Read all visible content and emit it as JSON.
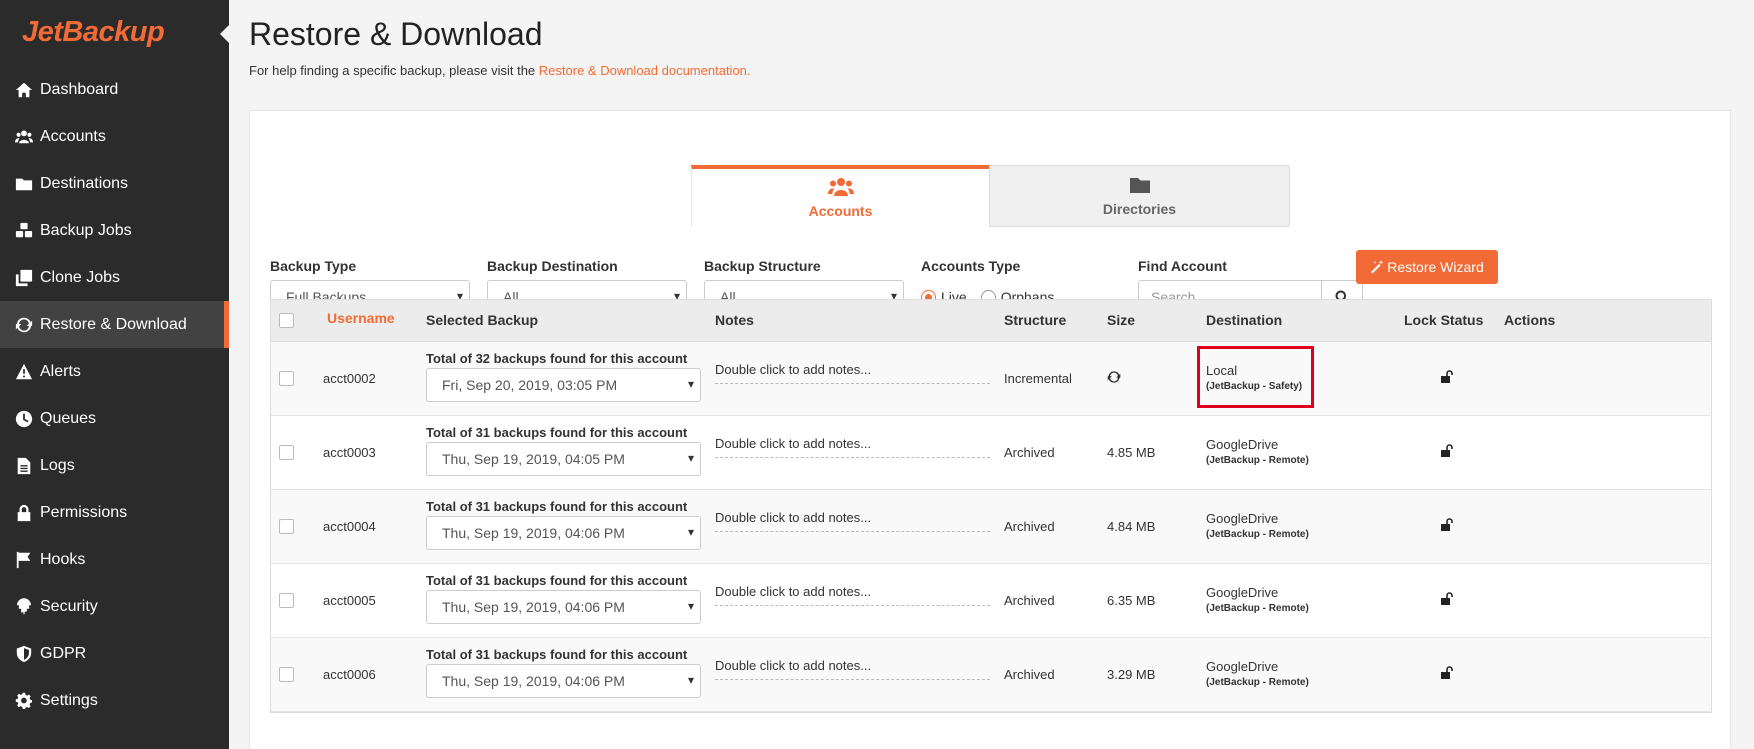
{
  "brand": {
    "logo_text": "JetBackup",
    "accent": "#f26b36"
  },
  "sidebar": {
    "items": [
      {
        "label": "Dashboard",
        "icon": "home-icon"
      },
      {
        "label": "Accounts",
        "icon": "users-icon"
      },
      {
        "label": "Destinations",
        "icon": "folder-icon"
      },
      {
        "label": "Backup Jobs",
        "icon": "cubes-icon"
      },
      {
        "label": "Clone Jobs",
        "icon": "clone-icon"
      },
      {
        "label": "Restore & Download",
        "icon": "refresh-icon",
        "active": true
      },
      {
        "label": "Alerts",
        "icon": "warning-icon"
      },
      {
        "label": "Queues",
        "icon": "clock-icon"
      },
      {
        "label": "Logs",
        "icon": "file-icon"
      },
      {
        "label": "Permissions",
        "icon": "lock-icon"
      },
      {
        "label": "Hooks",
        "icon": "flag-icon"
      },
      {
        "label": "Security",
        "icon": "fingerprint-icon"
      },
      {
        "label": "GDPR",
        "icon": "shield-icon"
      },
      {
        "label": "Settings",
        "icon": "gear-icon"
      }
    ]
  },
  "header": {
    "title": "Restore & Download",
    "help_prefix": "For help finding a specific backup, please visit the ",
    "help_link": "Restore & Download documentation."
  },
  "tabs": [
    {
      "label": "Accounts",
      "icon": "users-icon",
      "active": true
    },
    {
      "label": "Directories",
      "icon": "folder-icon",
      "active": false
    }
  ],
  "filters": {
    "backup_type": {
      "label": "Backup Type",
      "value": "Full Backups"
    },
    "backup_destination": {
      "label": "Backup Destination",
      "value": "All"
    },
    "backup_structure": {
      "label": "Backup Structure",
      "value": "All"
    },
    "accounts_type": {
      "label": "Accounts Type",
      "options": [
        "Live",
        "Orphans"
      ],
      "selected": "Live"
    },
    "find_account": {
      "label": "Find Account",
      "placeholder": "Search"
    }
  },
  "restore_wizard_label": "Restore Wizard",
  "table": {
    "headers": {
      "username": "Username",
      "selected_backup": "Selected Backup",
      "notes": "Notes",
      "structure": "Structure",
      "size": "Size",
      "destination": "Destination",
      "lock_status": "Lock Status",
      "actions": "Actions"
    },
    "rows": [
      {
        "username": "acct0002",
        "backup_count": "Total of 32 backups found for this account",
        "backup_date": "Fri, Sep 20, 2019, 03:05 PM",
        "notes": "Double click to add notes...",
        "structure": "Incremental",
        "size": "",
        "destination": "Local",
        "destination_sub": "(JetBackup - Safety)",
        "highlighted": true
      },
      {
        "username": "acct0003",
        "backup_count": "Total of 31 backups found for this account",
        "backup_date": "Thu, Sep 19, 2019, 04:05 PM",
        "notes": "Double click to add notes...",
        "structure": "Archived",
        "size": "4.85 MB",
        "destination": "GoogleDrive",
        "destination_sub": "(JetBackup - Remote)"
      },
      {
        "username": "acct0004",
        "backup_count": "Total of 31 backups found for this account",
        "backup_date": "Thu, Sep 19, 2019, 04:06 PM",
        "notes": "Double click to add notes...",
        "structure": "Archived",
        "size": "4.84 MB",
        "destination": "GoogleDrive",
        "destination_sub": "(JetBackup - Remote)"
      },
      {
        "username": "acct0005",
        "backup_count": "Total of 31 backups found for this account",
        "backup_date": "Thu, Sep 19, 2019, 04:06 PM",
        "notes": "Double click to add notes...",
        "structure": "Archived",
        "size": "6.35 MB",
        "destination": "GoogleDrive",
        "destination_sub": "(JetBackup - Remote)"
      },
      {
        "username": "acct0006",
        "backup_count": "Total of 31 backups found for this account",
        "backup_date": "Thu, Sep 19, 2019, 04:06 PM",
        "notes": "Double click to add notes...",
        "structure": "Archived",
        "size": "3.29 MB",
        "destination": "GoogleDrive",
        "destination_sub": "(JetBackup - Remote)"
      }
    ]
  }
}
